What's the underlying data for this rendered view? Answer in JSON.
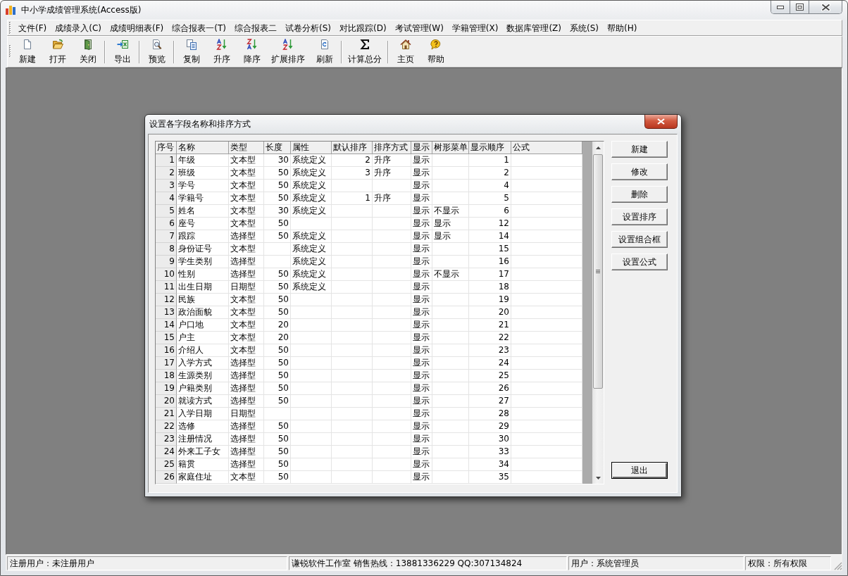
{
  "window": {
    "title": "中小学成绩管理系统(Access版)"
  },
  "menu": [
    "文件(F)",
    "成绩录入(C)",
    "成绩明细表(F)",
    "综合报表一(T)",
    "综合报表二",
    "试卷分析(S)",
    "对比跟踪(D)",
    "考试管理(W)",
    "学籍管理(X)",
    "数据库管理(Z)",
    "系统(S)",
    "帮助(H)"
  ],
  "toolbar": [
    [
      "新建",
      "打开",
      "关闭"
    ],
    [
      "导出"
    ],
    [
      "预览"
    ],
    [
      "复制",
      "升序",
      "降序",
      "扩展排序",
      "刷新"
    ],
    [
      "计算总分"
    ],
    [
      "主页",
      "帮助"
    ]
  ],
  "dialog": {
    "title": "设置各字段名称和排序方式",
    "table": {
      "columns": [
        "序号",
        "名称",
        "类型",
        "长度",
        "属性",
        "默认排序",
        "排序方式",
        "显示",
        "树形菜单",
        "显示顺序",
        "公式"
      ],
      "rows": [
        {
          "no": "1",
          "name": "年级",
          "type": "文本型",
          "length": "30",
          "attribute": "系统定义",
          "default_sort": "2",
          "sort_order": "升序",
          "display": "显示",
          "display_order": "1"
        },
        {
          "no": "2",
          "name": "班级",
          "type": "文本型",
          "length": "50",
          "attribute": "系统定义",
          "default_sort": "3",
          "sort_order": "升序",
          "display": "显示",
          "display_order": "2"
        },
        {
          "no": "3",
          "name": "学号",
          "type": "文本型",
          "length": "50",
          "attribute": "系统定义",
          "display": "显示",
          "display_order": "4"
        },
        {
          "no": "4",
          "name": "学籍号",
          "type": "文本型",
          "length": "50",
          "attribute": "系统定义",
          "default_sort": "1",
          "sort_order": "升序",
          "display": "显示",
          "display_order": "5"
        },
        {
          "no": "5",
          "name": "姓名",
          "type": "文本型",
          "length": "30",
          "attribute": "系统定义",
          "display": "显示",
          "tree_menu": "不显示",
          "display_order": "6"
        },
        {
          "no": "6",
          "name": "座号",
          "type": "文本型",
          "length": "50",
          "display": "显示",
          "tree_menu": "显示",
          "display_order": "12"
        },
        {
          "no": "7",
          "name": "跟踪",
          "type": "选择型",
          "length": "50",
          "attribute": "系统定义",
          "display": "显示",
          "tree_menu": "显示",
          "display_order": "14"
        },
        {
          "no": "8",
          "name": "身份证号",
          "type": "文本型",
          "attribute": "系统定义",
          "display": "显示",
          "display_order": "15"
        },
        {
          "no": "9",
          "name": "学生类别",
          "type": "选择型",
          "attribute": "系统定义",
          "display": "显示",
          "display_order": "16"
        },
        {
          "no": "10",
          "name": "性别",
          "type": "选择型",
          "length": "50",
          "attribute": "系统定义",
          "display": "显示",
          "tree_menu": "不显示",
          "display_order": "17"
        },
        {
          "no": "11",
          "name": "出生日期",
          "type": "日期型",
          "length": "50",
          "attribute": "系统定义",
          "display": "显示",
          "display_order": "18"
        },
        {
          "no": "12",
          "name": "民族",
          "type": "文本型",
          "length": "50",
          "display": "显示",
          "display_order": "19"
        },
        {
          "no": "13",
          "name": "政治面貌",
          "type": "文本型",
          "length": "50",
          "display": "显示",
          "display_order": "20"
        },
        {
          "no": "14",
          "name": "户口地",
          "type": "文本型",
          "length": "20",
          "display": "显示",
          "display_order": "21"
        },
        {
          "no": "15",
          "name": "户主",
          "type": "文本型",
          "length": "20",
          "display": "显示",
          "display_order": "22"
        },
        {
          "no": "16",
          "name": "介绍人",
          "type": "文本型",
          "length": "50",
          "display": "显示",
          "display_order": "23"
        },
        {
          "no": "17",
          "name": "入学方式",
          "type": "选择型",
          "length": "50",
          "display": "显示",
          "display_order": "24"
        },
        {
          "no": "18",
          "name": "生源类别",
          "type": "选择型",
          "length": "50",
          "display": "显示",
          "display_order": "25"
        },
        {
          "no": "19",
          "name": "户籍类别",
          "type": "选择型",
          "length": "50",
          "display": "显示",
          "display_order": "26"
        },
        {
          "no": "20",
          "name": "就读方式",
          "type": "选择型",
          "length": "50",
          "display": "显示",
          "display_order": "27"
        },
        {
          "no": "21",
          "name": "入学日期",
          "type": "日期型",
          "display": "显示",
          "display_order": "28"
        },
        {
          "no": "22",
          "name": "选修",
          "type": "选择型",
          "length": "50",
          "display": "显示",
          "display_order": "29"
        },
        {
          "no": "23",
          "name": "注册情况",
          "type": "选择型",
          "length": "50",
          "display": "显示",
          "display_order": "30"
        },
        {
          "no": "24",
          "name": "外来工子女",
          "type": "选择型",
          "length": "50",
          "display": "显示",
          "display_order": "33"
        },
        {
          "no": "25",
          "name": "籍贯",
          "type": "选择型",
          "length": "50",
          "display": "显示",
          "display_order": "34"
        },
        {
          "no": "26",
          "name": "家庭住址",
          "type": "文本型",
          "length": "50",
          "display": "显示",
          "display_order": "35"
        }
      ]
    },
    "buttons": [
      "新建",
      "修改",
      "删除",
      "设置排序",
      "设置组合框",
      "设置公式"
    ],
    "exit_button": {
      "label": "退出",
      "focused": true
    }
  },
  "status_bar": [
    "注册用户：未注册用户",
    "谦锐软件工作室 销售热线：13881336229 QQ:307134824",
    "用户：系统管理员",
    "权限：所有权限"
  ]
}
